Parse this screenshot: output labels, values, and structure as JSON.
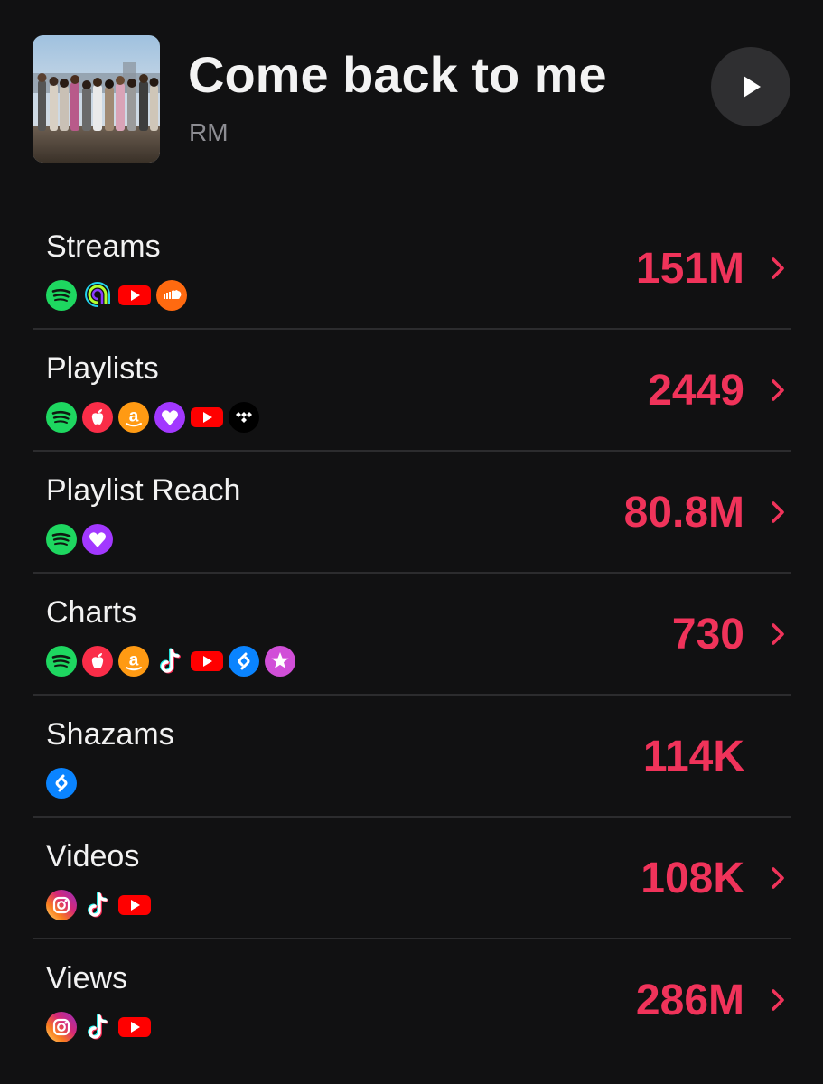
{
  "song": {
    "title": "Come back to me",
    "artist": "RM"
  },
  "colors": {
    "background": "#111112",
    "accent": "#f0335a",
    "divider": "#2c2c2e",
    "muted": "#8e8e93"
  },
  "rows": [
    {
      "label": "Streams",
      "value": "151M",
      "chevron": true,
      "icons": [
        "spotify-icon",
        "anghami-icon",
        "youtube-icon",
        "soundcloud-icon"
      ]
    },
    {
      "label": "Playlists",
      "value": "2449",
      "chevron": true,
      "icons": [
        "spotify-icon",
        "apple-music-icon",
        "amazon-music-icon",
        "deezer-icon",
        "youtube-icon",
        "tidal-icon"
      ]
    },
    {
      "label": "Playlist Reach",
      "value": "80.8M",
      "chevron": true,
      "icons": [
        "spotify-icon",
        "deezer-icon"
      ]
    },
    {
      "label": "Charts",
      "value": "730",
      "chevron": true,
      "icons": [
        "spotify-icon",
        "apple-music-icon",
        "amazon-music-icon",
        "tiktok-icon",
        "youtube-icon",
        "shazam-icon",
        "itunes-icon"
      ]
    },
    {
      "label": "Shazams",
      "value": "114K",
      "chevron": false,
      "icons": [
        "shazam-icon"
      ]
    },
    {
      "label": "Videos",
      "value": "108K",
      "chevron": true,
      "icons": [
        "instagram-icon",
        "tiktok-icon",
        "youtube-icon"
      ]
    },
    {
      "label": "Views",
      "value": "286M",
      "chevron": true,
      "icons": [
        "instagram-icon",
        "tiktok-icon",
        "youtube-icon"
      ]
    }
  ]
}
